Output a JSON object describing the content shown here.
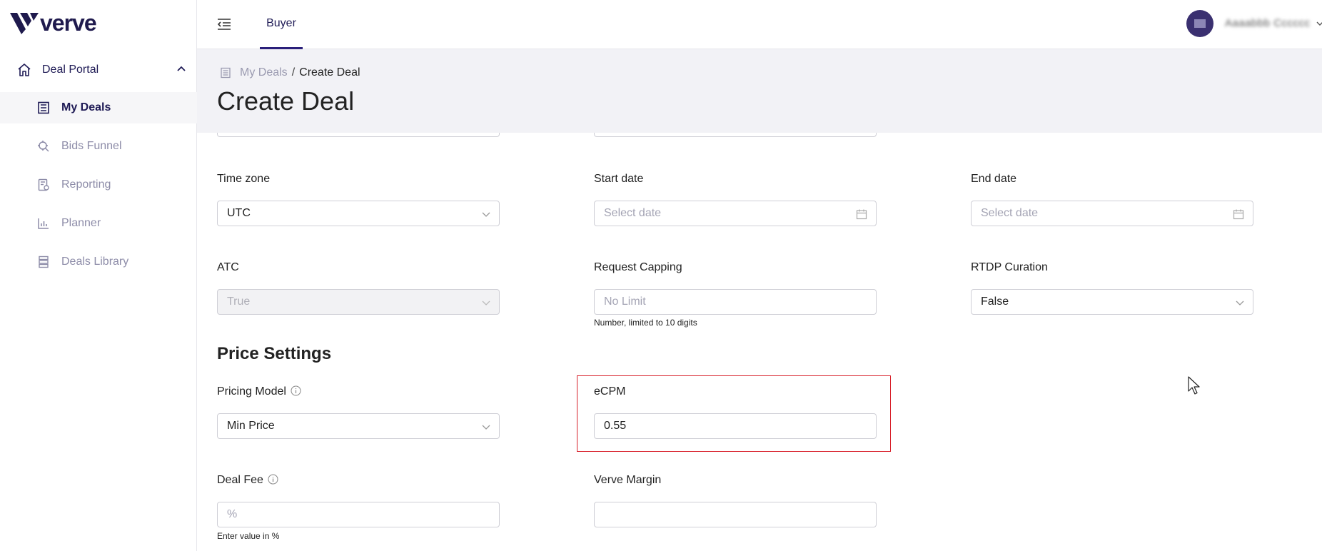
{
  "app": {
    "logo_text": "verve"
  },
  "sidebar": {
    "section_label": "Deal Portal",
    "items": [
      {
        "label": "My Deals",
        "icon": "deals-icon",
        "active": true
      },
      {
        "label": "Bids Funnel",
        "icon": "funnel-icon",
        "active": false
      },
      {
        "label": "Reporting",
        "icon": "reporting-icon",
        "active": false
      },
      {
        "label": "Planner",
        "icon": "planner-icon",
        "active": false
      },
      {
        "label": "Deals Library",
        "icon": "library-icon",
        "active": false
      }
    ]
  },
  "topbar": {
    "tab_label": "Buyer",
    "user_name": "Aaaabbb Cccccc"
  },
  "breadcrumb": {
    "parent": "My Deals",
    "separator": "/",
    "current": "Create Deal"
  },
  "page": {
    "title": "Create Deal"
  },
  "form": {
    "time_zone": {
      "label": "Time zone",
      "value": "UTC"
    },
    "start_date": {
      "label": "Start date",
      "placeholder": "Select date"
    },
    "end_date": {
      "label": "End date",
      "placeholder": "Select date"
    },
    "atc": {
      "label": "ATC",
      "value": "True"
    },
    "request_capping": {
      "label": "Request Capping",
      "placeholder": "No Limit",
      "hint": "Number, limited to 10 digits"
    },
    "rtdp_curation": {
      "label": "RTDP Curation",
      "value": "False"
    },
    "price_section_title": "Price Settings",
    "pricing_model": {
      "label": "Pricing Model",
      "value": "Min Price"
    },
    "ecpm": {
      "label": "eCPM",
      "value": "0.55"
    },
    "deal_fee": {
      "label": "Deal Fee",
      "placeholder": "%",
      "hint": "Enter value in %"
    },
    "verve_margin": {
      "label": "Verve Margin",
      "value": ""
    }
  },
  "colors": {
    "brand": "#1f1a4d",
    "highlight": "#d8202a",
    "header_bg": "#f2f2f6"
  }
}
